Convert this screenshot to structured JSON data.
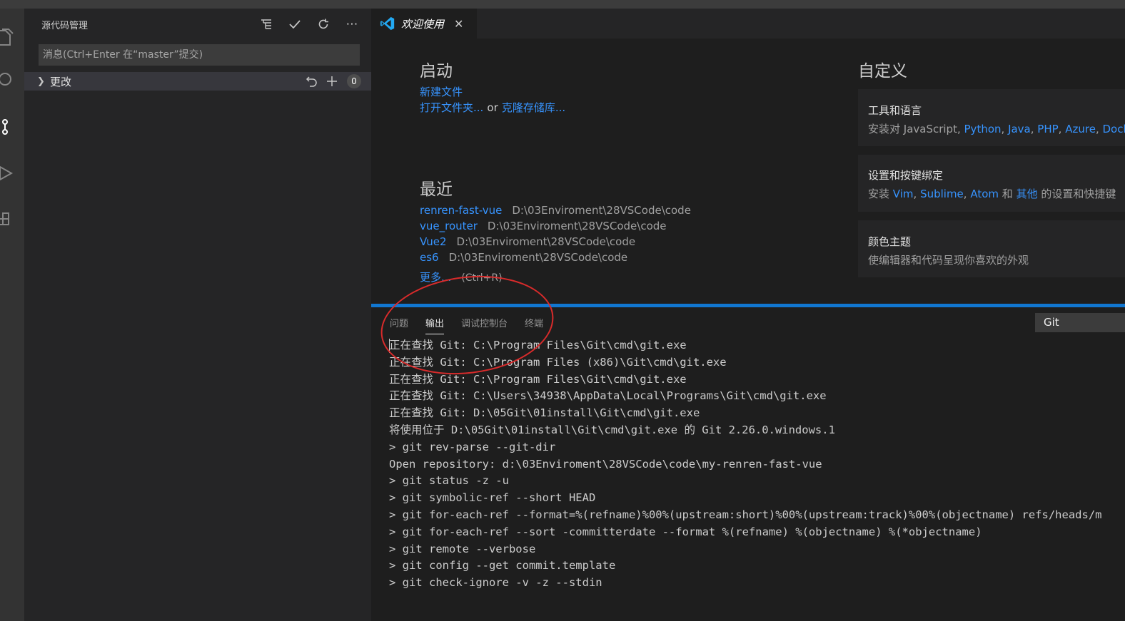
{
  "sidebar": {
    "title": "源代码管理",
    "commit_placeholder": "消息(Ctrl+Enter 在“master”提交)",
    "changes_label": "更改",
    "changes_count": "0"
  },
  "tab": {
    "label": "欢迎使用"
  },
  "welcome": {
    "start_heading": "启动",
    "new_file": "新建文件",
    "open_folder": "打开文件夹...",
    "or_text": "or",
    "clone_repo": "克隆存储库...",
    "recent_heading": "最近",
    "recent": [
      {
        "name": "renren-fast-vue",
        "path": "D:\\03Enviroment\\28VSCode\\code"
      },
      {
        "name": "vue_router",
        "path": "D:\\03Enviroment\\28VSCode\\code"
      },
      {
        "name": "Vue2",
        "path": "D:\\03Enviroment\\28VSCode\\code"
      },
      {
        "name": "es6",
        "path": "D:\\03Enviroment\\28VSCode\\code"
      }
    ],
    "more": "更多...",
    "more_shortcut": "(Ctrl+R)",
    "customize_heading": "自定义",
    "cards": [
      {
        "title": "工具和语言",
        "desc_prefix": "安装对 JavaScript,",
        "links": [
          "Python",
          "Java",
          "PHP",
          "Azure",
          "Docke"
        ]
      },
      {
        "title": "设置和按键绑定",
        "desc_prefix": "安装",
        "links": [
          "Vim",
          "Sublime",
          "Atom"
        ],
        "and_text": "和",
        "other_link": "其他",
        "desc_suffix": "的设置和快捷键"
      },
      {
        "title": "颜色主题",
        "desc": "使编辑器和代码呈现你喜欢的外观"
      }
    ]
  },
  "panel": {
    "tabs": [
      "问题",
      "输出",
      "调试控制台",
      "终端"
    ],
    "active_tab": "输出",
    "channel": "Git",
    "output_lines": [
      "正在查找 Git: C:\\Program Files\\Git\\cmd\\git.exe",
      "正在查找 Git: C:\\Program Files (x86)\\Git\\cmd\\git.exe",
      "正在查找 Git: C:\\Program Files\\Git\\cmd\\git.exe",
      "正在查找 Git: C:\\Users\\34938\\AppData\\Local\\Programs\\Git\\cmd\\git.exe",
      "正在查找 Git: D:\\05Git\\01install\\Git\\cmd\\git.exe",
      "将使用位于 D:\\05Git\\01install\\Git\\cmd\\git.exe 的 Git 2.26.0.windows.1",
      "> git rev-parse --git-dir",
      "Open repository: d:\\03Enviroment\\28VSCode\\code\\my-renren-fast-vue",
      "> git status -z -u",
      "> git symbolic-ref --short HEAD",
      "> git for-each-ref --format=%(refname)%00%(upstream:short)%00%(upstream:track)%00%(objectname) refs/heads/m",
      "> git for-each-ref --sort -committerdate --format %(refname) %(objectname) %(*objectname)",
      "> git remote --verbose",
      "> git config --get commit.template",
      "> git check-ignore -v -z --stdin"
    ]
  },
  "colors": {
    "accent": "#1177d1",
    "link": "#3794ff",
    "annotation": "#d92b2b"
  }
}
